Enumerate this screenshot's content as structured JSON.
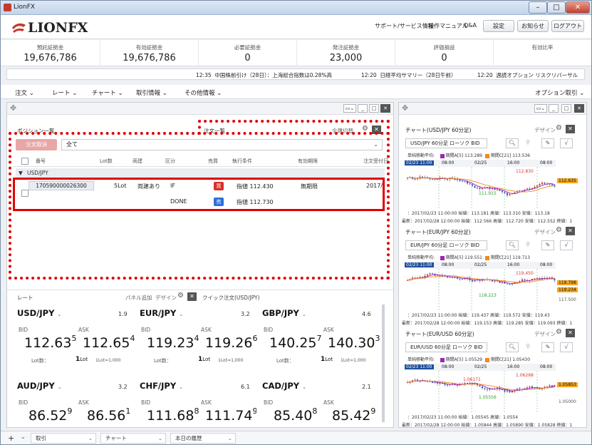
{
  "window": {
    "title": "LionFX"
  },
  "header": {
    "logo_text": "LIONFX",
    "links": [
      "サポート/サービス情報",
      "操作マニュアル",
      "Q&A"
    ],
    "buttons": [
      "設定",
      "お知らせ",
      "ログアウト"
    ]
  },
  "summary": [
    {
      "label": "預託証拠金",
      "value": "19,676,786"
    },
    {
      "label": "有効証拠金",
      "value": "19,676,786"
    },
    {
      "label": "必要証拠金",
      "value": "0"
    },
    {
      "label": "発注証拠金",
      "value": "23,000"
    },
    {
      "label": "評価損益",
      "value": "0"
    },
    {
      "label": "有効比率",
      "value": ""
    }
  ],
  "ticker": [
    {
      "time": "12:35",
      "text": "中国株前引け（28日）：上海総合指数は0.28%高"
    },
    {
      "time": "12:20",
      "text": "日経平均サマリー（28日午前）"
    },
    {
      "time": "12:20",
      "text": "週読オプション リスクリバーサル"
    }
  ],
  "menu": {
    "items": [
      "注文",
      "レート",
      "チャート",
      "取引情報",
      "その他情報"
    ],
    "right": "オプション取引"
  },
  "orders": {
    "tab_positions": "ポジション一覧",
    "tab_orders": "注文一覧",
    "switch_label": "全建切替",
    "cancel_button": "注文取消",
    "filter_value": "全て",
    "columns": [
      "番号",
      "Lot数",
      "両建",
      "区分",
      "売買",
      "執行条件",
      "有効期限",
      "注文受付日"
    ],
    "group": "USD/JPY",
    "row": {
      "id": "170590000026300",
      "lots": "5Lot",
      "hedge": "両建あり",
      "type1": "IF",
      "side1": "買",
      "cond1": "指値 112.430",
      "expiry": "無期限",
      "date": "2017/",
      "type2": "DONE",
      "side2": "売",
      "cond2": "指値 112.730"
    }
  },
  "rates": {
    "title": "レート",
    "panel_add": "パネル追加",
    "design": "デザイン",
    "quick_order": "クイック注文(USD/JPY)",
    "bid_label": "BID",
    "ask_label": "ASK",
    "lot_label": "Lot数：",
    "lot_value": "1",
    "lot_unit": "Lot",
    "lot_note": "1Lot=1,000",
    "pairs": [
      {
        "name": "USD/JPY",
        "spread": "1.9",
        "bid_main": "112.63",
        "bid_pip": "5",
        "ask_main": "112.65",
        "ask_pip": "4"
      },
      {
        "name": "EUR/JPY",
        "spread": "3.2",
        "bid_main": "119.23",
        "bid_pip": "4",
        "ask_main": "119.26",
        "ask_pip": "6"
      },
      {
        "name": "GBP/JPY",
        "spread": "4.6",
        "bid_main": "140.25",
        "bid_pip": "7",
        "ask_main": "140.30",
        "ask_pip": "3"
      },
      {
        "name": "AUD/JPY",
        "spread": "3.2",
        "bid_main": "86.52",
        "bid_pip": "9",
        "ask_main": "86.56",
        "ask_pip": "1"
      },
      {
        "name": "CHF/JPY",
        "spread": "6.1",
        "bid_main": "111.68",
        "bid_pip": "8",
        "ask_main": "111.74",
        "ask_pip": "9"
      },
      {
        "name": "CAD/JPY",
        "spread": "2.1",
        "bid_main": "85.40",
        "bid_pip": "8",
        "ask_main": "85.42",
        "ask_pip": "9"
      }
    ]
  },
  "charts": [
    {
      "title": "チャート(USD/JPY 60分足)",
      "design": "デザイン",
      "select": "USD/JPY 60分足 ローソク BID",
      "legend": [
        "単純移動平均:",
        "期間A[5] 113.289",
        "期間C[21] 113.536"
      ],
      "time_labels": [
        "02/23 11:00",
        "08:00",
        "02/25",
        "16:00",
        "08:00"
      ],
      "high_label": "112.830",
      "low_label": "111.915",
      "price_tag": "112.635",
      "ohlc1": "：2017/02/23 11:00:00 始値：113.181 高値：113.310 安値：113.18",
      "ohlc2": "最新：2017/02/28 12:00:00 始値：112.566 高値：112.720 安値：112.552 終値：1",
      "color_a": "#9c27b0",
      "color_c": "#f08a1c"
    },
    {
      "title": "チャート(EUR/JPY 60分足)",
      "design": "デザイン",
      "select": "EUR/JPY 60分足 ローソク BID",
      "legend": [
        "単純移動平均:",
        "期間A[5] 119.551",
        "期間C[21] 119.713"
      ],
      "time_labels": [
        "02/23 11:00",
        "08:00",
        "02/25",
        "16:00",
        "08:00"
      ],
      "high_label": "119.450",
      "low_label": "118.223",
      "price_tag": "119.798",
      "price_tag2": "119.234",
      "axis_label": "117.500",
      "ohlc1": "：2017/02/23 11:00:00 始値：119.437 高値：119.572 安値：119.43",
      "ohlc2": "最新：2017/02/28 12:00:00 始値：119.153 高値：119.285 安値：119.093 終値：1",
      "color_a": "#9c27b0",
      "color_c": "#f08a1c"
    },
    {
      "title": "チャート(EUR/USD 60分足)",
      "design": "デザイン",
      "select": "EUR/USD 60分足 ローソク BID",
      "legend": [
        "単純移動平均:",
        "期間A[5] 1.05529",
        "期間C[21] 1.05430"
      ],
      "time_labels": [
        "02/23 11:00",
        "08:00",
        "02/25",
        "16:00",
        "08:00"
      ],
      "high_label": "1.06298",
      "high_label2": "1.06171",
      "low_label": "1.05556",
      "price_tag": "1.05853",
      "axis_label": "1.05000",
      "ohlc1": "：2017/02/23 11:00:00 始値：1.05545 高値：1.0554",
      "ohlc2": "最新：2017/02/28 12:00:00 始値：1.05844 高値：1.05890 安値：1.05828 終値：1",
      "color_a": "#9c27b0",
      "color_c": "#f08a1c"
    }
  ],
  "bottom": {
    "tabs": [
      "取引",
      "チャート",
      "本日の履歴"
    ]
  }
}
